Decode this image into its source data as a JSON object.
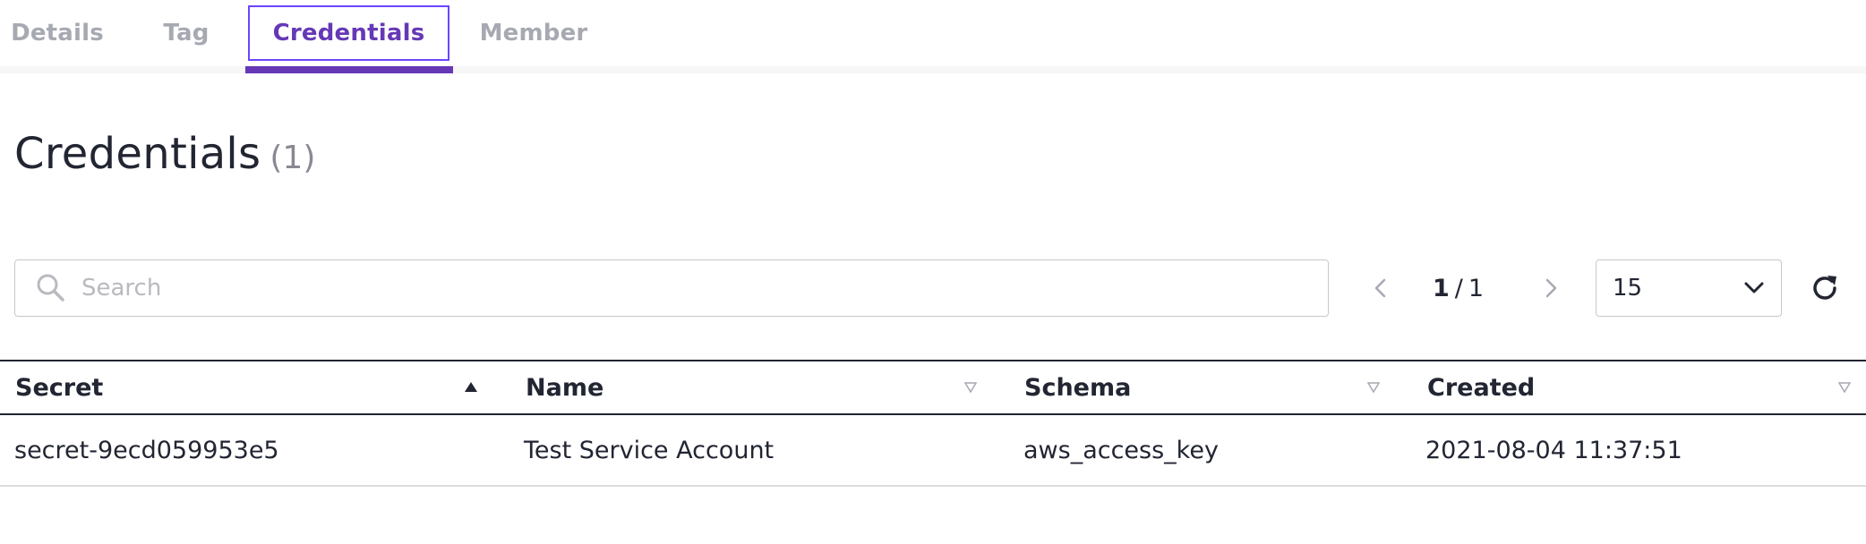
{
  "tabs": [
    {
      "label": "Details"
    },
    {
      "label": "Tag"
    },
    {
      "label": "Credentials"
    },
    {
      "label": "Member"
    }
  ],
  "active_tab": "Credentials",
  "heading": {
    "title": "Credentials",
    "count": "(1)"
  },
  "search": {
    "placeholder": "Search",
    "value": ""
  },
  "pagination": {
    "current": "1",
    "separator": "/",
    "total": "1"
  },
  "page_size": {
    "value": "15"
  },
  "table": {
    "columns": [
      {
        "label": "Secret",
        "sort": "ascending"
      },
      {
        "label": "Name",
        "sort": "none"
      },
      {
        "label": "Schema",
        "sort": "none"
      },
      {
        "label": "Created",
        "sort": "none"
      }
    ],
    "rows": [
      {
        "secret": "secret-9ecd059953e5",
        "name": "Test Service Account",
        "schema": "aws_access_key",
        "created": "2021-08-04 11:37:51"
      }
    ]
  },
  "icons": [
    "search-icon",
    "chevron-left-icon",
    "chevron-right-icon",
    "chevron-down-icon",
    "refresh-icon",
    "sort-ascending-icon",
    "sort-icon"
  ],
  "colors": {
    "accent": "#6638b6",
    "focus_ring": "#6c45ff",
    "text": "#222532",
    "muted": "#a7a9b2"
  }
}
